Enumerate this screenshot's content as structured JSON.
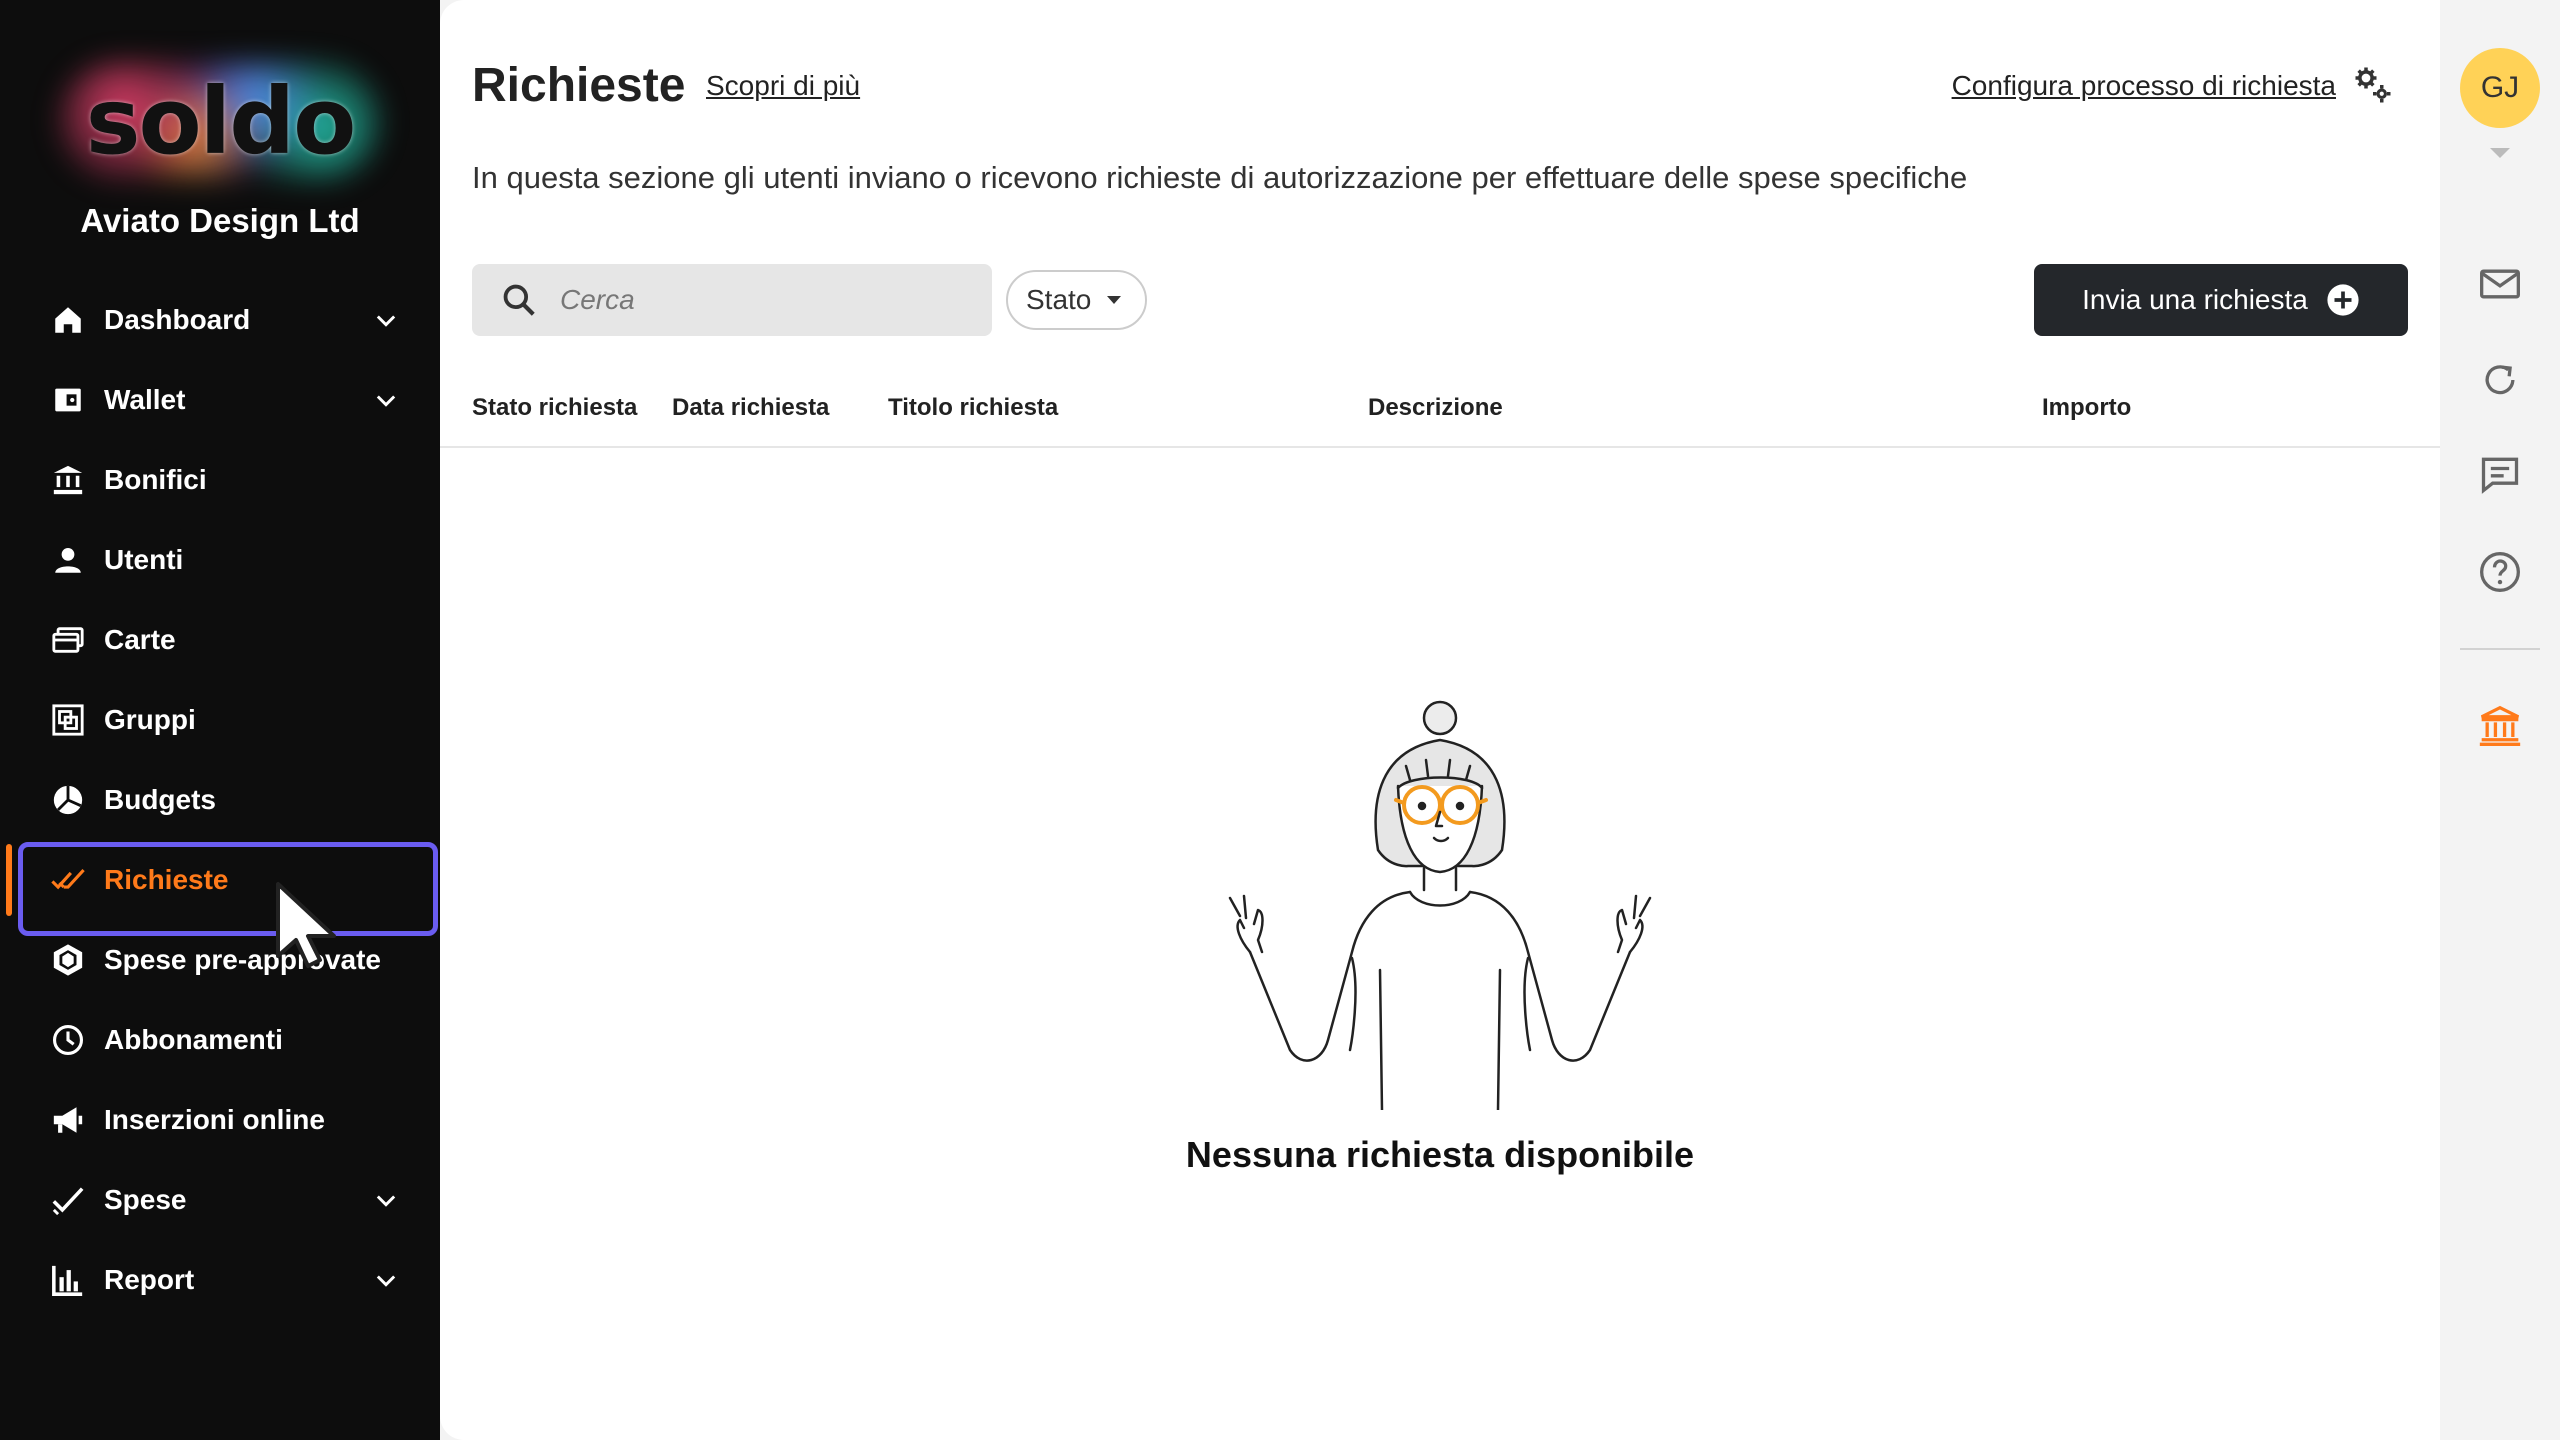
{
  "brand": {
    "logo_text": "soldo",
    "company": "Aviato Design Ltd",
    "accent": "#ff7a1a",
    "highlight": "#6a5cf0"
  },
  "sidebar": {
    "items": [
      {
        "label": "Dashboard",
        "icon": "home-icon",
        "expandable": true
      },
      {
        "label": "Wallet",
        "icon": "wallet-icon",
        "expandable": true
      },
      {
        "label": "Bonifici",
        "icon": "bank-transfer-icon",
        "expandable": false
      },
      {
        "label": "Utenti",
        "icon": "user-icon",
        "expandable": false
      },
      {
        "label": "Carte",
        "icon": "cards-icon",
        "expandable": false
      },
      {
        "label": "Gruppi",
        "icon": "groups-icon",
        "expandable": false
      },
      {
        "label": "Budgets",
        "icon": "pie-chart-icon",
        "expandable": false
      },
      {
        "label": "Richieste",
        "icon": "double-check-icon",
        "expandable": false,
        "active": true
      },
      {
        "label": "Spese pre-approvate",
        "icon": "hexagon-icon",
        "expandable": false
      },
      {
        "label": "Abbonamenti",
        "icon": "clock-icon",
        "expandable": false
      },
      {
        "label": "Inserzioni online",
        "icon": "megaphone-icon",
        "expandable": false
      },
      {
        "label": "Spese",
        "icon": "check-icon",
        "expandable": true
      },
      {
        "label": "Report",
        "icon": "bar-chart-icon",
        "expandable": true
      }
    ]
  },
  "header": {
    "title": "Richieste",
    "learn_more": "Scopri di più",
    "configure": "Configura processo di richiesta",
    "subtitle": "In questa sezione gli utenti inviano o ricevono richieste di autorizzazione per effettuare delle spese specifiche"
  },
  "toolbar": {
    "search_placeholder": "Cerca",
    "status_filter": "Stato",
    "send_request": "Invia una richiesta"
  },
  "table": {
    "columns": [
      "Stato richiesta",
      "Data richiesta",
      "Titolo richiesta",
      "Descrizione",
      "Importo"
    ]
  },
  "empty_state": {
    "message": "Nessuna richiesta disponibile"
  },
  "rail": {
    "avatar_initials": "GJ",
    "avatar_color": "#ffd257"
  }
}
